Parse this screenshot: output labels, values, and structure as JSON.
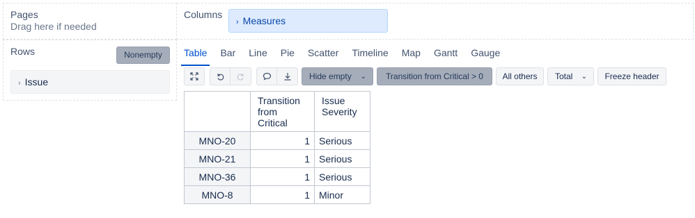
{
  "pages": {
    "title": "Pages",
    "hint": "Drag here if needed"
  },
  "rows": {
    "title": "Rows",
    "nonempty_label": "Nonempty",
    "items": [
      {
        "label": "Issue"
      }
    ]
  },
  "columns": {
    "title": "Columns",
    "items": [
      {
        "label": "Measures"
      }
    ]
  },
  "tabs": [
    "Table",
    "Bar",
    "Line",
    "Pie",
    "Scatter",
    "Timeline",
    "Map",
    "Gantt",
    "Gauge"
  ],
  "active_tab": "Table",
  "toolbar": {
    "hide_empty_label": "Hide empty",
    "filter_label": "Transition from Critical > 0",
    "all_others_label": "All others",
    "total_label": "Total",
    "freeze_header_label": "Freeze header"
  },
  "table": {
    "headers": [
      "Transition from Critical",
      "Issue Severity"
    ],
    "rows": [
      {
        "name": "MNO-20",
        "transition": "1",
        "severity": "Serious"
      },
      {
        "name": "MNO-21",
        "transition": "1",
        "severity": "Serious"
      },
      {
        "name": "MNO-36",
        "transition": "1",
        "severity": "Serious"
      },
      {
        "name": "MNO-8",
        "transition": "1",
        "severity": "Minor"
      }
    ]
  },
  "icons": {
    "expand": "expand-icon",
    "undo": "undo-icon",
    "redo": "redo-icon",
    "comment": "comment-icon",
    "download": "download-icon"
  }
}
